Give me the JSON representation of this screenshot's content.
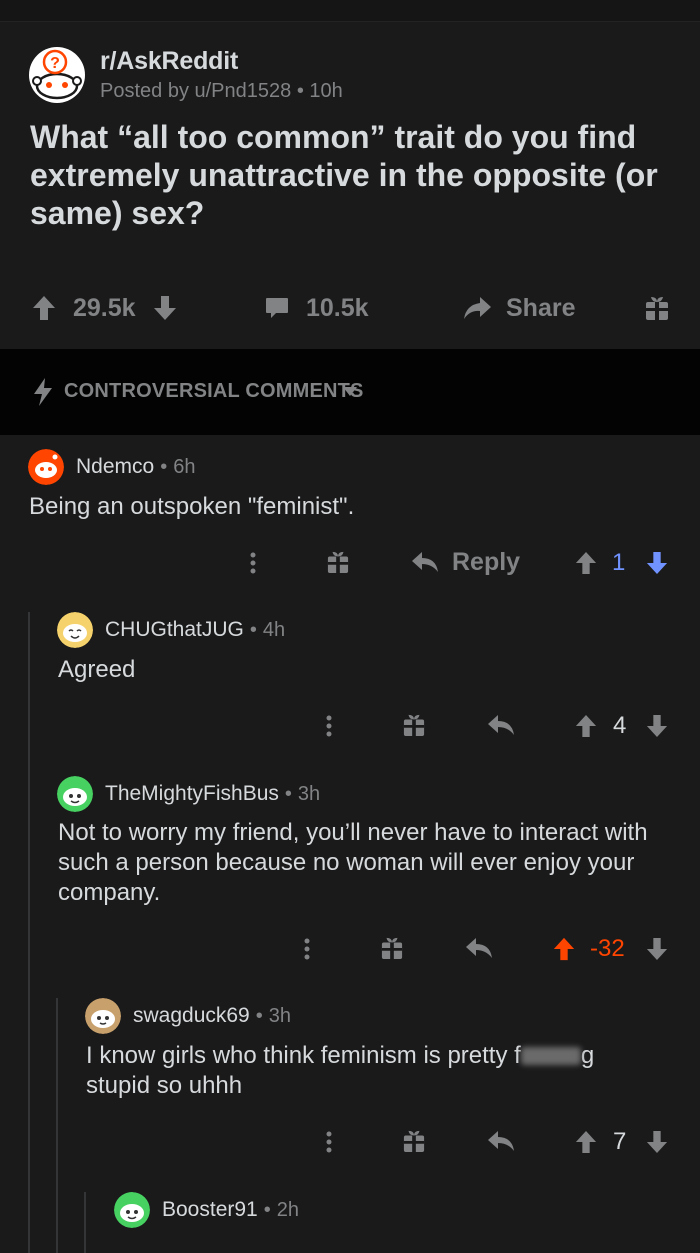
{
  "post": {
    "subreddit": "r/AskReddit",
    "posted_by": "Posted by u/Pnd1528",
    "age": "10h",
    "title": "What “all too common” trait do you find extremely unattractive in the opposite (or same) sex?",
    "upvotes": "29.5k",
    "comments": "10.5k",
    "share_label": "Share"
  },
  "sort": {
    "label": "CONTROVERSIAL COMMENTS"
  },
  "comments": [
    {
      "author": "Ndemco",
      "time": "6h",
      "body": "Being an outspoken \"feminist\".",
      "reply_label": "Reply",
      "score": "1"
    },
    {
      "author": "CHUGthatJUG",
      "time": "4h",
      "body": "Agreed",
      "score": "4"
    },
    {
      "author": "TheMightyFishBus",
      "time": "3h",
      "body": "Not to worry my friend, you’ll never have to interact with such a person because no woman will ever enjoy your company.",
      "score": "-32"
    },
    {
      "author": "swagduck69",
      "time": "3h",
      "body_start": "I know girls who think feminism is pretty f",
      "body_end": "g",
      "body_line2": "stupid so uhhh",
      "score": "7"
    },
    {
      "author": "Booster91",
      "time": "2h"
    }
  ],
  "colors": {
    "background": "#1a1a1b",
    "sort_bar": "#030303",
    "text": "#d7dadc",
    "muted": "#818384",
    "upvoted": "#ff4500",
    "downvoted": "#7193ff"
  }
}
